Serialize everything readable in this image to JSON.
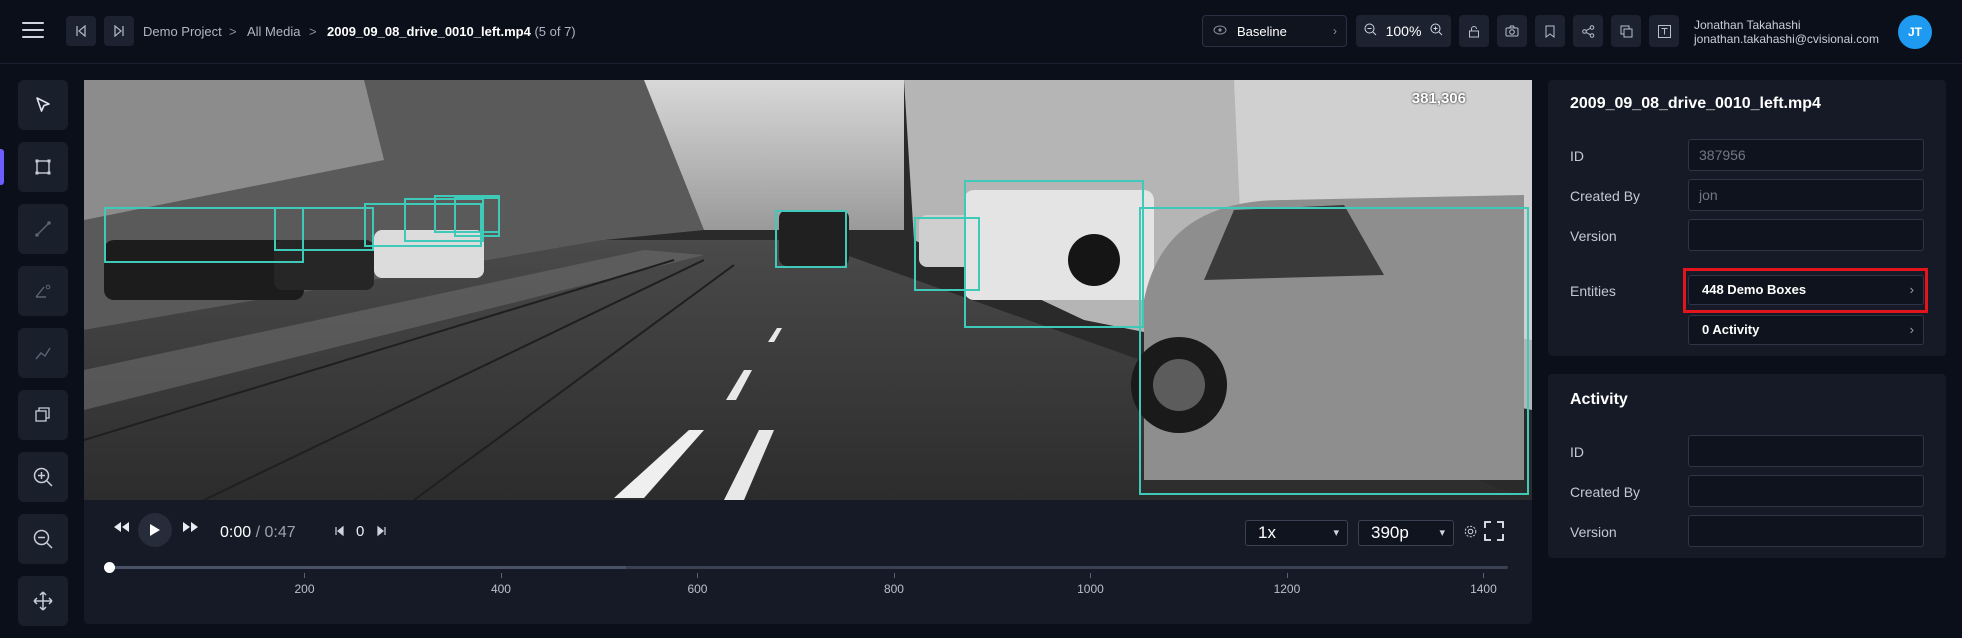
{
  "header": {
    "breadcrumb": [
      "Demo Project",
      "All Media"
    ],
    "breadcrumb_sep": ">",
    "file_name": "2009_09_08_drive_0010_left.mp4",
    "file_position": "(5 of 7)",
    "layer_select": "Baseline",
    "zoom_level": "100%",
    "user_name": "Jonathan Takahashi",
    "user_email": "jonathan.takahashi@cvisionai.com",
    "avatar_initials": "JT"
  },
  "toolbar_icons": [
    "pointer-icon",
    "box-icon",
    "line-icon",
    "point-icon",
    "track-icon",
    "clone-icon",
    "zoom-in-icon",
    "zoom-out-icon",
    "pan-icon"
  ],
  "video": {
    "frame_label": "381,306"
  },
  "player": {
    "current_time": "0:00",
    "duration": "/ 0:47",
    "frame_number": "0",
    "playback_rate": "1x",
    "quality": "390p",
    "timeline_ticks": [
      "200",
      "400",
      "600",
      "800",
      "1000",
      "1200",
      "1400"
    ],
    "progress_fraction": 0.37
  },
  "media_panel": {
    "title": "2009_09_08_drive_0010_left.mp4",
    "fields": [
      {
        "label": "ID",
        "value": "387956"
      },
      {
        "label": "Created By",
        "value": "jon"
      },
      {
        "label": "Version",
        "value": ""
      }
    ],
    "entities_label": "Entities",
    "entities": [
      {
        "label": "448 Demo Boxes"
      },
      {
        "label": "0 Activity"
      }
    ]
  },
  "activity_panel": {
    "title": "Activity",
    "fields": [
      {
        "label": "ID",
        "value": ""
      },
      {
        "label": "Created By",
        "value": ""
      },
      {
        "label": "Version",
        "value": ""
      }
    ]
  },
  "colors": {
    "accent": "#6d5dfc",
    "box": "#3fc9b8",
    "avatar": "#1e9bf0",
    "highlight": "#e3141b"
  }
}
